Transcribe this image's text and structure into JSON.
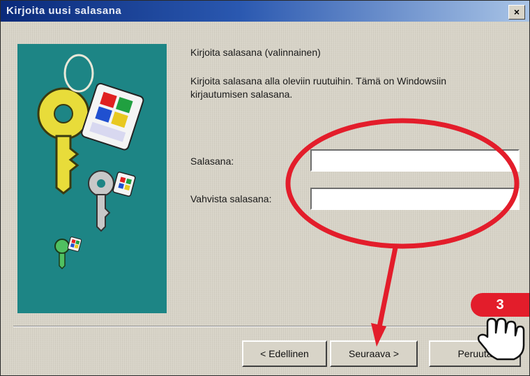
{
  "window": {
    "title": "Kirjoita uusi salasana",
    "close_label": "×"
  },
  "content": {
    "heading": "Kirjoita salasana (valinnainen)",
    "description": "Kirjoita salasana alla oleviin ruutuihin. Tämä on Windowsiin kirjautumisen salasana.",
    "password_label": "Salasana:",
    "password_value": "",
    "confirm_label": "Vahvista salasana:",
    "confirm_value": ""
  },
  "buttons": {
    "back_label": "< Edellinen",
    "next_label": "Seuraava >",
    "cancel_label": "Peruuta"
  },
  "annotation": {
    "step_number": "3",
    "color": "#e31d2b"
  },
  "colors": {
    "art_background": "#1d8585",
    "dialog_background": "#d8d4c8"
  },
  "icons": [
    "key-icon",
    "windows-logo-icon",
    "hand-cursor-icon",
    "arrow-icon"
  ]
}
